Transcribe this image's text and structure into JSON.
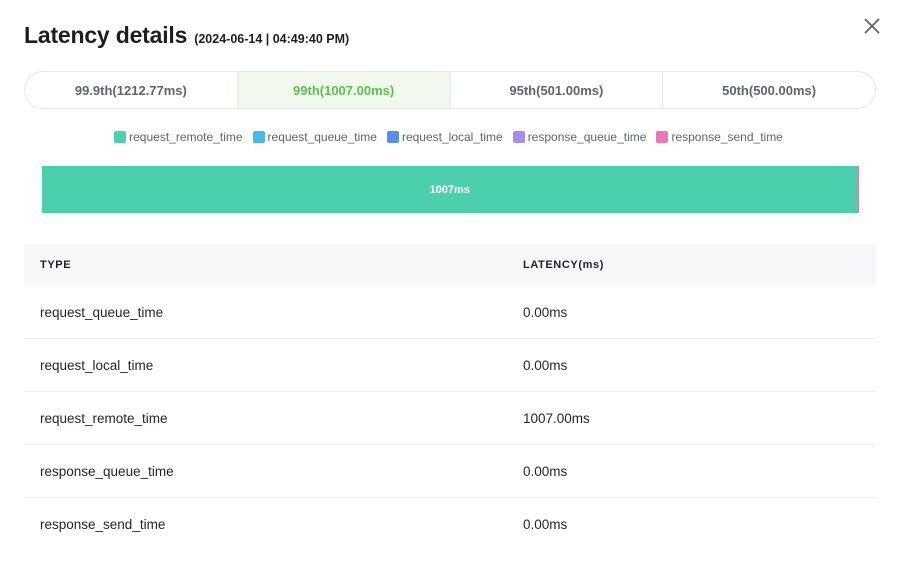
{
  "modal": {
    "title": "Latency details",
    "timestamp": "(2024-06-14 | 04:49:40 PM)"
  },
  "tabs": [
    {
      "label": "99.9th(1212.77ms)",
      "active": false
    },
    {
      "label": "99th(1007.00ms)",
      "active": true
    },
    {
      "label": "95th(501.00ms)",
      "active": false
    },
    {
      "label": "50th(500.00ms)",
      "active": false
    }
  ],
  "legend": [
    {
      "label": "request_remote_time",
      "color": "#4ccfad"
    },
    {
      "label": "request_queue_time",
      "color": "#4bb8e8"
    },
    {
      "label": "request_local_time",
      "color": "#5a8ee6"
    },
    {
      "label": "response_queue_time",
      "color": "#a98ded"
    },
    {
      "label": "response_send_time",
      "color": "#e879b6"
    }
  ],
  "stacked_bar": {
    "label": "1007ms",
    "segments": [
      {
        "name": "request_remote_time",
        "value": 1007.0,
        "color": "#4ccfad"
      },
      {
        "name": "request_queue_time",
        "value": 0.0,
        "color": "#4bb8e8"
      },
      {
        "name": "request_local_time",
        "value": 0.0,
        "color": "#5a8ee6"
      },
      {
        "name": "response_queue_time",
        "value": 0.0,
        "color": "#a98ded"
      },
      {
        "name": "response_send_time",
        "value": 2.0,
        "color": "#e879b6"
      }
    ]
  },
  "table": {
    "headers": [
      "TYPE",
      "LATENCY(ms)"
    ],
    "rows": [
      {
        "type": "request_queue_time",
        "latency": "0.00ms"
      },
      {
        "type": "request_local_time",
        "latency": "0.00ms"
      },
      {
        "type": "request_remote_time",
        "latency": "1007.00ms"
      },
      {
        "type": "response_queue_time",
        "latency": "0.00ms"
      },
      {
        "type": "response_send_time",
        "latency": "0.00ms"
      }
    ]
  },
  "icons": {
    "close": "close-icon"
  }
}
